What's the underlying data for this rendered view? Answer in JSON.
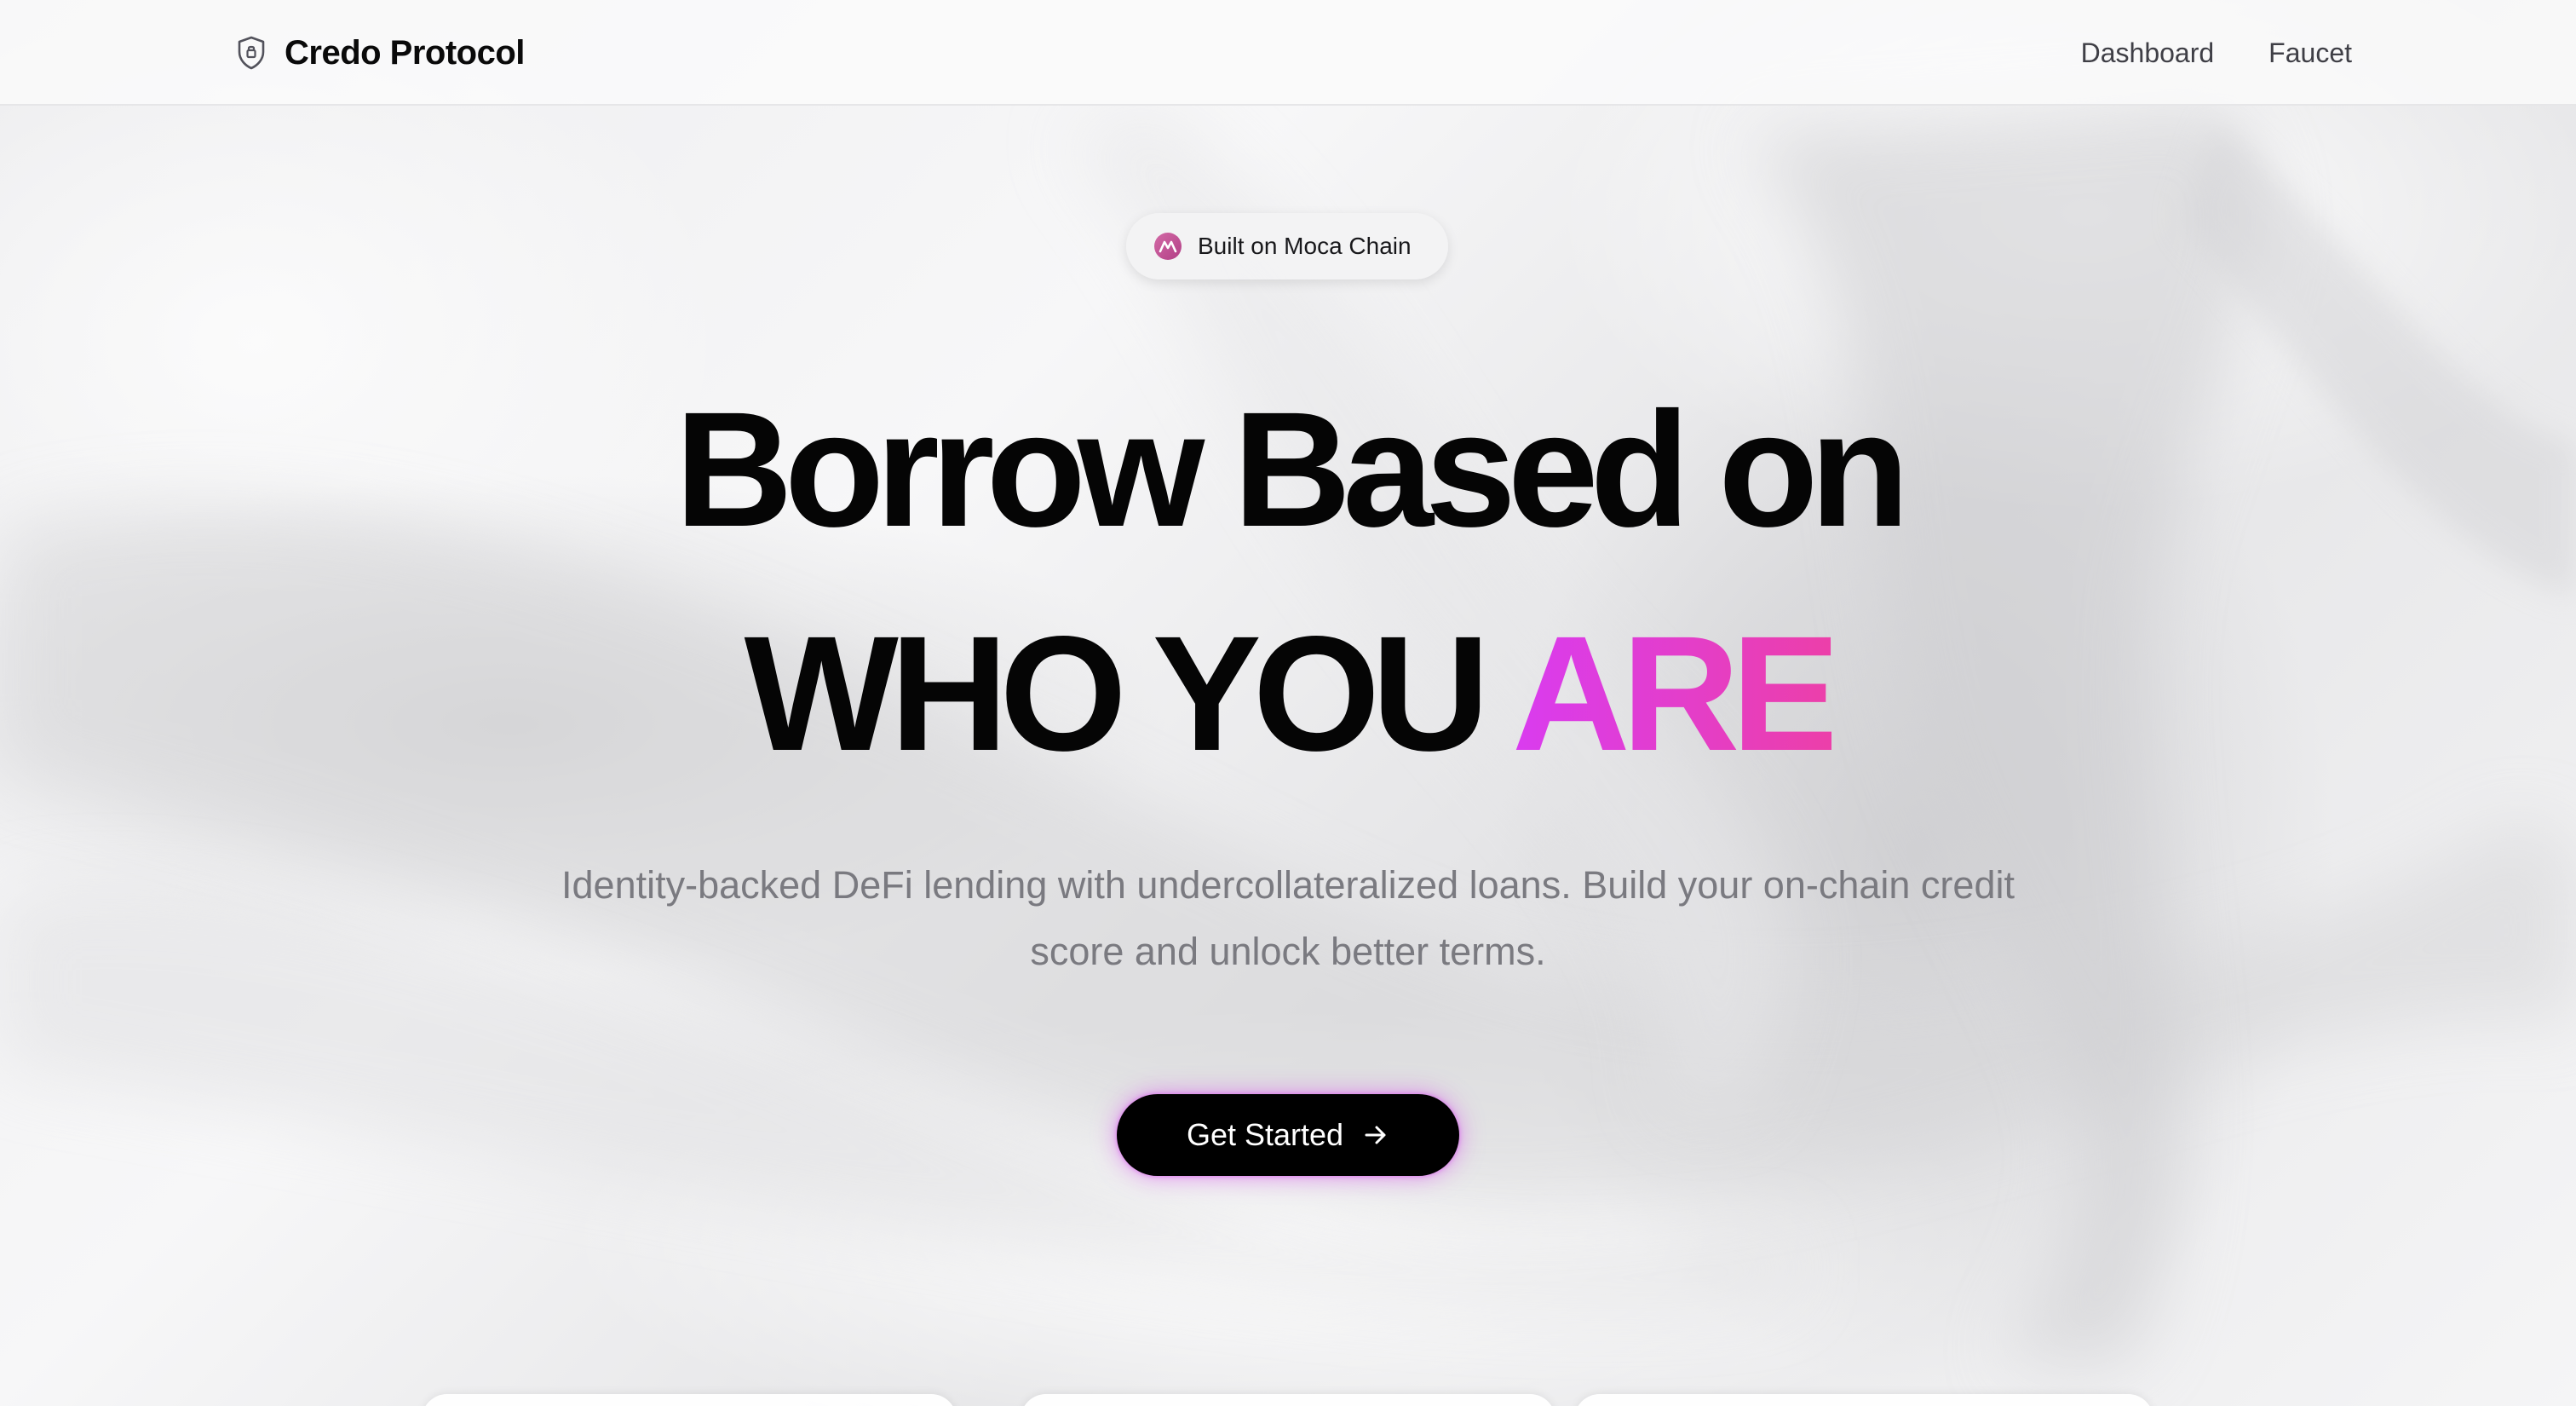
{
  "header": {
    "brand_name": "Credo Protocol",
    "brand_icon": "shield-icon",
    "nav": [
      {
        "label": "Dashboard"
      },
      {
        "label": "Faucet"
      }
    ]
  },
  "hero": {
    "badge": {
      "label": "Built on Moca Chain",
      "icon": "moca-logo-icon"
    },
    "headline_line1": "Borrow Based on",
    "headline_line2_main": "WHO YOU ",
    "headline_line2_accent": "ARE",
    "subtext_line1": "Identity-backed DeFi lending with undercollateralized loans. Build your on-chain credit",
    "subtext_line2": "score and unlock better terms.",
    "cta": {
      "label": "Get Started",
      "icon": "arrow-right-icon"
    }
  },
  "colors": {
    "accent_start": "#d93cf0",
    "accent_end": "#ec3fa9",
    "cta_background": "#000000",
    "badge_icon": "#c84f9a"
  }
}
